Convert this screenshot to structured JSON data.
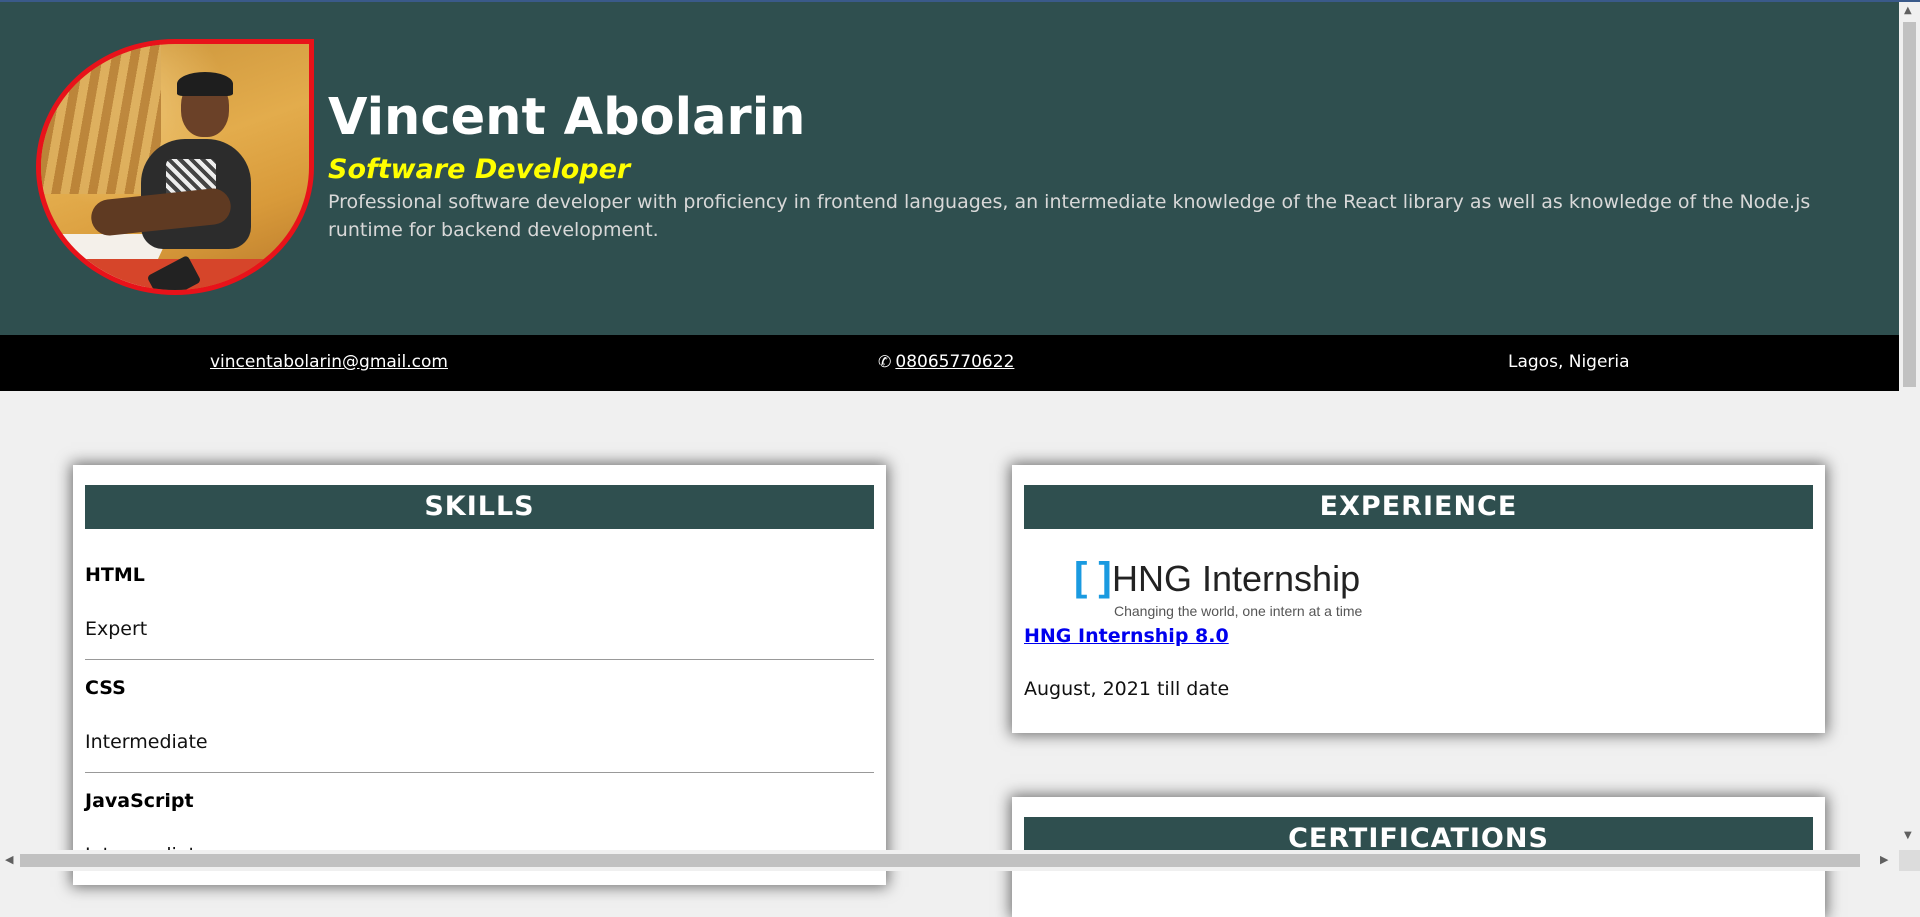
{
  "header": {
    "name": "Vincent Abolarin",
    "role": "Software Developer",
    "bio": "Professional software developer with proficiency in frontend languages, an intermediate knowledge of the React library as well as knowledge of the Node.js runtime for backend development."
  },
  "contact": {
    "email": "vincentabolarin@gmail.com",
    "phone_icon": "phone-icon",
    "phone": "08065770622",
    "location": "Lagos, Nigeria"
  },
  "skills": {
    "title": "SKILLS",
    "items": [
      {
        "name": "HTML",
        "level": "Expert"
      },
      {
        "name": "CSS",
        "level": "Intermediate"
      },
      {
        "name": "JavaScript",
        "level": "Intermediate"
      }
    ]
  },
  "experience": {
    "title": "EXPERIENCE",
    "logo_bracket": "[ ]",
    "logo_text": "HNG Internship",
    "logo_tagline": "Changing the world, one intern at a time",
    "link_label": "HNG Internship 8.0",
    "date": "August, 2021 till date"
  },
  "certifications": {
    "title": "CERTIFICATIONS"
  },
  "colors": {
    "header_bg": "#2f4f4f",
    "role_text": "#ffff00",
    "avatar_border": "#e8121a",
    "contact_bar": "#000000"
  }
}
